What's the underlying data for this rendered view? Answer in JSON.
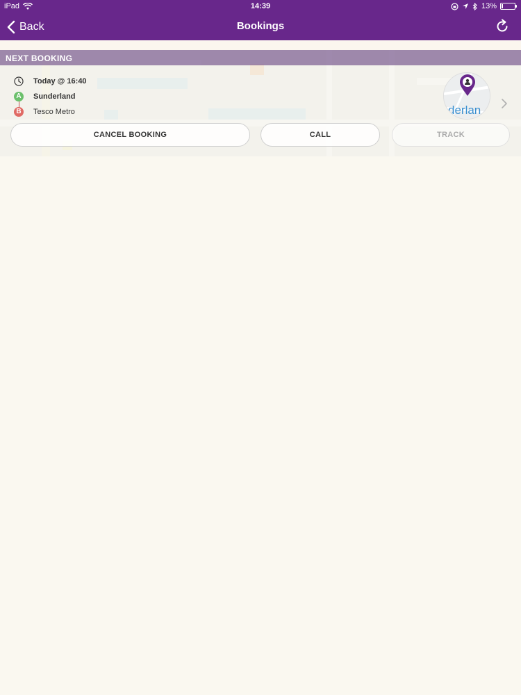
{
  "status_bar": {
    "device": "iPad",
    "time": "14:39",
    "battery": "13%",
    "battery_level": 0.13
  },
  "nav": {
    "back_label": "Back",
    "title": "Bookings"
  },
  "next_booking": {
    "header": "NEXT BOOKING",
    "time_text": "Today @ 16:40",
    "pickup_marker": "A",
    "pickup": "Sunderland",
    "dropoff_marker": "B",
    "dropoff": "Tesco Metro",
    "map_label": "derlan",
    "buttons": {
      "cancel": "CANCEL BOOKING",
      "call": "CALL",
      "track": "TRACK"
    }
  },
  "colors": {
    "brand_purple": "#68278b",
    "pickup_green": "#6cc06c",
    "dropoff_red": "#e06a64"
  }
}
